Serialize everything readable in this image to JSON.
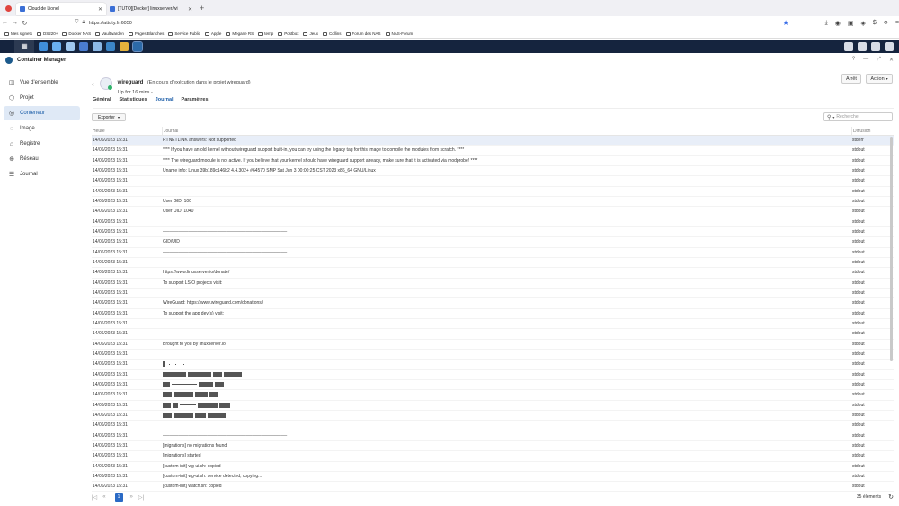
{
  "browser": {
    "tabs": [
      {
        "title": "Cloud de Lionel",
        "active": true
      },
      {
        "title": "[TUTO][Docker] linuxserver/wi",
        "active": false
      }
    ],
    "url": "https://attuty.fr:6050",
    "bookmarks": [
      "Mes signets",
      "DS220+",
      "Docker NAS",
      "Vaultwarden",
      "Pages Blanches",
      "Service Public",
      "Apple",
      "Megane RS",
      "temp",
      "Postbox",
      "Jeux",
      "Collins",
      "Forum des NAS",
      "NAS-Forum"
    ]
  },
  "window": {
    "title": "Container Manager"
  },
  "sidebar": {
    "items": [
      {
        "label": "Vue d'ensemble",
        "icon": "dashboard-icon",
        "active": false
      },
      {
        "label": "Projet",
        "icon": "project-icon",
        "active": false
      },
      {
        "label": "Conteneur",
        "icon": "container-icon",
        "active": true
      },
      {
        "label": "Image",
        "icon": "image-icon",
        "active": false
      },
      {
        "label": "Registre",
        "icon": "registry-icon",
        "active": false
      },
      {
        "label": "Réseau",
        "icon": "network-icon",
        "active": false
      },
      {
        "label": "Journal",
        "icon": "log-icon",
        "active": false
      }
    ]
  },
  "container": {
    "name": "wireguard",
    "status": "(En cours d'exécution dans le projet wireguard)",
    "uptime": "Up for 16 mins -",
    "stop_label": "Arrêt",
    "action_label": "Action",
    "tabs": [
      "Général",
      "Statistiques",
      "Journal",
      "Paramètres"
    ],
    "active_tab": "Journal"
  },
  "toolbar": {
    "export_label": "Exporter",
    "search_placeholder": "Recherche"
  },
  "table": {
    "headers": [
      "Heure",
      "Journal",
      "Diffusion"
    ],
    "rows": [
      {
        "time": "14/06/2023 15:31",
        "log": "RTNETLINK answers: Not supported",
        "stream": "stderr"
      },
      {
        "time": "14/06/2023 15:31",
        "log": "**** If you have an old kernel without wireguard support built-in, you can try using the legacy tag for this image to compile the modules from scratch. ****",
        "stream": "stdout"
      },
      {
        "time": "14/06/2023 15:31",
        "log": "**** The wireguard module is not active. If you believe that your kernel should have wireguard support already, make sure that it is activated via modprobe! ****",
        "stream": "stdout"
      },
      {
        "time": "14/06/2023 15:31",
        "log": "Uname info: Linux 39b189c146b2 4.4.302+ #64570 SMP Sat Jun 3 00:00:25 CST 2023 x86_64 GNU/Linux",
        "stream": "stdout"
      },
      {
        "time": "14/06/2023 15:31",
        "log": "",
        "stream": "stdout"
      },
      {
        "time": "14/06/2023 15:31",
        "log": "───────────────────────────────────────",
        "stream": "stdout"
      },
      {
        "time": "14/06/2023 15:31",
        "log": "User GID: 100",
        "stream": "stdout"
      },
      {
        "time": "14/06/2023 15:31",
        "log": "User UID: 1040",
        "stream": "stdout"
      },
      {
        "time": "14/06/2023 15:31",
        "log": "",
        "stream": "stdout"
      },
      {
        "time": "14/06/2023 15:31",
        "log": "───────────────────────────────────────",
        "stream": "stdout"
      },
      {
        "time": "14/06/2023 15:31",
        "log": "GID/UID",
        "stream": "stdout"
      },
      {
        "time": "14/06/2023 15:31",
        "log": "───────────────────────────────────────",
        "stream": "stdout"
      },
      {
        "time": "14/06/2023 15:31",
        "log": "",
        "stream": "stdout"
      },
      {
        "time": "14/06/2023 15:31",
        "log": "https://www.linuxserver.io/donate/",
        "stream": "stdout"
      },
      {
        "time": "14/06/2023 15:31",
        "log": "To support LSIO projects visit:",
        "stream": "stdout"
      },
      {
        "time": "14/06/2023 15:31",
        "log": "",
        "stream": "stdout"
      },
      {
        "time": "14/06/2023 15:31",
        "log": "WireGuard: https://www.wireguard.com/donations/",
        "stream": "stdout"
      },
      {
        "time": "14/06/2023 15:31",
        "log": "To support the app dev(s) visit:",
        "stream": "stdout"
      },
      {
        "time": "14/06/2023 15:31",
        "log": "",
        "stream": "stdout"
      },
      {
        "time": "14/06/2023 15:31",
        "log": "───────────────────────────────────────",
        "stream": "stdout"
      },
      {
        "time": "14/06/2023 15:31",
        "log": "Brought to you by linuxserver.io",
        "stream": "stdout"
      },
      {
        "time": "14/06/2023 15:31",
        "log": "",
        "stream": "stdout"
      },
      {
        "time": "14/06/2023 15:31",
        "log": "",
        "stream": "stdout",
        "art": 1
      },
      {
        "time": "14/06/2023 15:31",
        "log": "",
        "stream": "stdout",
        "art": 2
      },
      {
        "time": "14/06/2023 15:31",
        "log": "",
        "stream": "stdout",
        "art": 3
      },
      {
        "time": "14/06/2023 15:31",
        "log": "",
        "stream": "stdout",
        "art": 4
      },
      {
        "time": "14/06/2023 15:31",
        "log": "",
        "stream": "stdout",
        "art": 5
      },
      {
        "time": "14/06/2023 15:31",
        "log": "",
        "stream": "stdout",
        "art": 6
      },
      {
        "time": "14/06/2023 15:31",
        "log": "",
        "stream": "stdout"
      },
      {
        "time": "14/06/2023 15:31",
        "log": "───────────────────────────────────────",
        "stream": "stdout"
      },
      {
        "time": "14/06/2023 15:31",
        "log": "[migrations] no migrations found",
        "stream": "stdout"
      },
      {
        "time": "14/06/2023 15:31",
        "log": "[migrations] started",
        "stream": "stdout"
      },
      {
        "time": "14/06/2023 15:31",
        "log": "[custom-init] wg-ui.sh: copied",
        "stream": "stdout"
      },
      {
        "time": "14/06/2023 15:31",
        "log": "[custom-init] wg-ui.sh: service detected, copying...",
        "stream": "stdout"
      },
      {
        "time": "14/06/2023 15:31",
        "log": "[custom-init] watch.sh: copied",
        "stream": "stdout"
      }
    ]
  },
  "pagination": {
    "current_page": "1",
    "total_label": "35 éléments"
  }
}
